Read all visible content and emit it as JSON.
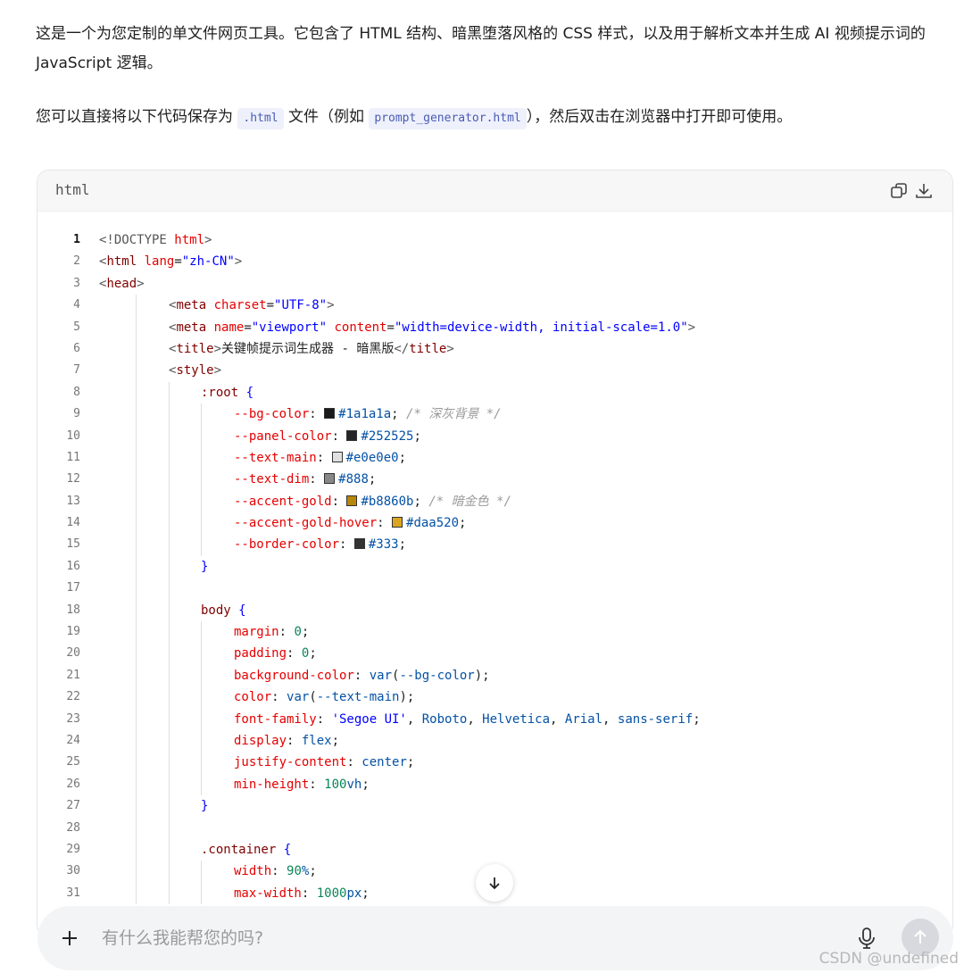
{
  "intro": {
    "p1": "这是一个为您定制的单文件网页工具。它包含了 HTML 结构、暗黑堕落风格的 CSS 样式，以及用于解析文本并生成 AI 视频提示词的 JavaScript 逻辑。",
    "p2_before": "您可以直接将以下代码保存为 ",
    "p2_code1": ".html",
    "p2_mid": " 文件（例如 ",
    "p2_code2": "prompt_generator.html",
    "p2_after": "），然后双击在浏览器中打开即可使用。"
  },
  "codeblock": {
    "language": "html",
    "copy_icon": "copy-icon",
    "download_icon": "download-icon",
    "line_numbers": [
      "1",
      "2",
      "3",
      "4",
      "5",
      "6",
      "7",
      "8",
      "9",
      "10",
      "11",
      "12",
      "13",
      "14",
      "15",
      "16",
      "17",
      "18",
      "19",
      "20",
      "21",
      "22",
      "23",
      "24",
      "25",
      "26",
      "27",
      "28",
      "29",
      "30",
      "31"
    ]
  },
  "colors": {
    "bg_color": "#1a1a1a",
    "panel_color": "#252525",
    "text_main": "#e0e0e0",
    "text_dim": "#888",
    "accent_gold": "#b8860b",
    "accent_gold_hover": "#daa520",
    "border_color": "#333"
  },
  "input": {
    "placeholder": "有什么我能帮您的吗?"
  },
  "watermark": "CSDN @undefined"
}
